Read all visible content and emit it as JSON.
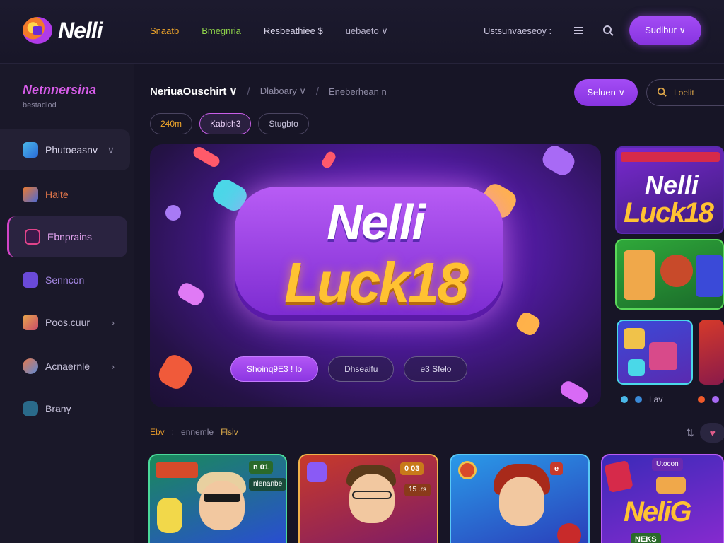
{
  "header": {
    "logo_text": "Nelli",
    "nav": [
      "Snaatb",
      "Bmegnria",
      "Resbeathiee $",
      "uebaeto ∨"
    ],
    "account_text": "Ustsunvaeseoy :",
    "cta_label": "Sudibur ∨"
  },
  "sidebar": {
    "title": "Netnnersina",
    "subtitle": "bestadiod",
    "items": [
      {
        "label": "Phutoeasnv",
        "chevron": "∨"
      },
      {
        "label": "Haite"
      },
      {
        "label": "Ebnprains"
      },
      {
        "label": "Senncon"
      },
      {
        "label": "Poos.cuur",
        "chevron": "›"
      },
      {
        "label": "Acnaernle",
        "chevron": "›"
      },
      {
        "label": "Brany"
      }
    ]
  },
  "main": {
    "breadcrumb": [
      "NeriuaOuschirt ∨",
      "Dlaboary ∨",
      "Eneberhean n"
    ],
    "select_label": "Seluen ∨",
    "search_placeholder": "Loelit",
    "chips": [
      "240m",
      "Kabich3",
      "Stugbto"
    ],
    "hero": {
      "line1": "Nelli",
      "line2": "Luck18",
      "buttons": [
        "Shoinq9E3 ! lo",
        "Dhseaifu",
        "e3 Sfelo"
      ]
    },
    "side_thumb": {
      "title1": "Nelli",
      "title2": "Luck18",
      "caption": "Lav"
    },
    "section_row": [
      "Ebv",
      ":",
      "ennemle",
      "Flsiv"
    ],
    "cards": [
      {
        "tag": "n 01",
        "sub": "nlenanbe"
      },
      {
        "tag": "0 03",
        "sub": "15 .rs"
      },
      {
        "tag": "e"
      },
      {
        "title": "NeliG",
        "sub": "Utocon",
        "caption": "NEKS"
      }
    ]
  },
  "colors": {
    "accent": "#a44cf5",
    "gold": "#ffc232",
    "background": "#171526"
  }
}
